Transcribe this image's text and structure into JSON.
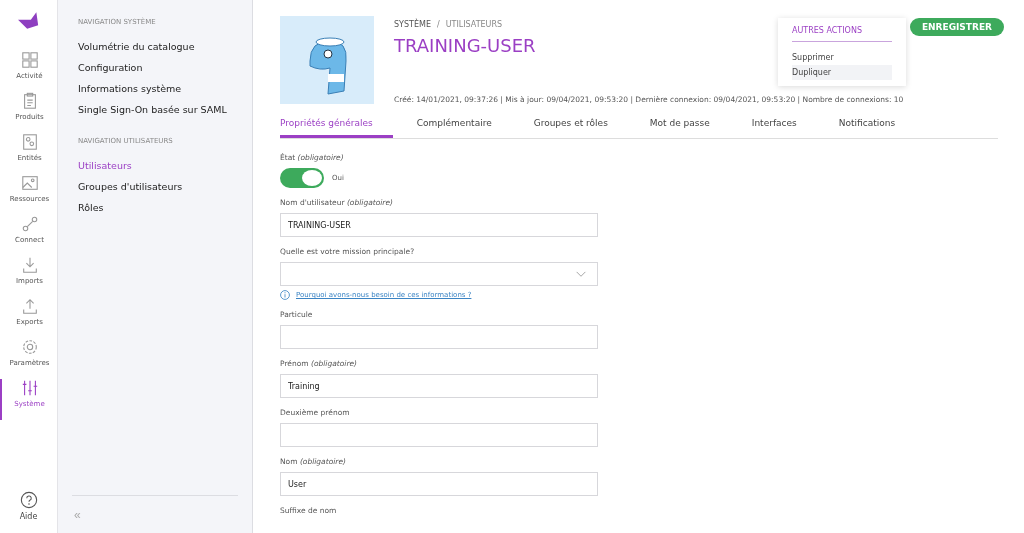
{
  "rail": {
    "items": [
      {
        "label": "Activité",
        "selected": false
      },
      {
        "label": "Produits",
        "selected": false
      },
      {
        "label": "Entités",
        "selected": false
      },
      {
        "label": "Ressources",
        "selected": false
      },
      {
        "label": "Connect",
        "selected": false
      },
      {
        "label": "Imports",
        "selected": false
      },
      {
        "label": "Exports",
        "selected": false
      },
      {
        "label": "Paramètres",
        "selected": false
      },
      {
        "label": "Système",
        "selected": true
      }
    ],
    "help": "Aide"
  },
  "nav": {
    "sections": [
      {
        "title": "NAVIGATION SYSTÈME",
        "items": [
          {
            "label": "Volumétrie du catalogue",
            "selected": false
          },
          {
            "label": "Configuration",
            "selected": false
          },
          {
            "label": "Informations système",
            "selected": false
          },
          {
            "label": "Single Sign-On basée sur SAML",
            "selected": false
          }
        ]
      },
      {
        "title": "NAVIGATION UTILISATEURS",
        "items": [
          {
            "label": "Utilisateurs",
            "selected": true
          },
          {
            "label": "Groupes d'utilisateurs",
            "selected": false
          },
          {
            "label": "Rôles",
            "selected": false
          }
        ]
      }
    ],
    "collapse": "«"
  },
  "header": {
    "breadcrumb": [
      "SYSTÈME",
      "UTILISATEURS"
    ],
    "separator": "/",
    "title": "TRAINING-USER",
    "meta": "Créé: 14/01/2021, 09:37:26 | Mis à jour: 09/04/2021, 09:53:20 | Dernière connexion: 09/04/2021, 09:53:20 | Nombre de connexions: 10",
    "save": "ENREGISTRER",
    "menu": {
      "title": "AUTRES ACTIONS",
      "items": [
        {
          "label": "Supprimer",
          "selected": false
        },
        {
          "label": "Dupliquer",
          "selected": true
        }
      ]
    }
  },
  "tabs": [
    {
      "label": "Propriétés générales",
      "selected": true
    },
    {
      "label": "Complémentaire",
      "selected": false
    },
    {
      "label": "Groupes et rôles",
      "selected": false
    },
    {
      "label": "Mot de passe",
      "selected": false
    },
    {
      "label": "Interfaces",
      "selected": false
    },
    {
      "label": "Notifications",
      "selected": false
    }
  ],
  "fields": [
    {
      "kind": "toggle",
      "label": "État *(obligatoire)*",
      "on": true,
      "value": "Oui"
    },
    {
      "kind": "text",
      "label": "Nom d'utilisateur *(obligatoire)*",
      "value": "TRAINING-USER"
    },
    {
      "kind": "select",
      "label": "Quelle est votre mission principale?",
      "help": "Pourquoi avons-nous besoin de ces informations ?"
    },
    {
      "kind": "text",
      "label": "Particule"
    },
    {
      "kind": "text",
      "label": "Prénom *(obligatoire)*",
      "value": "Training"
    },
    {
      "kind": "text",
      "label": "Deuxième prénom"
    },
    {
      "kind": "text",
      "label": "Nom *(obligatoire)*",
      "value": "User"
    },
    {
      "kind": "label",
      "label": "Suffixe de nom"
    }
  ]
}
